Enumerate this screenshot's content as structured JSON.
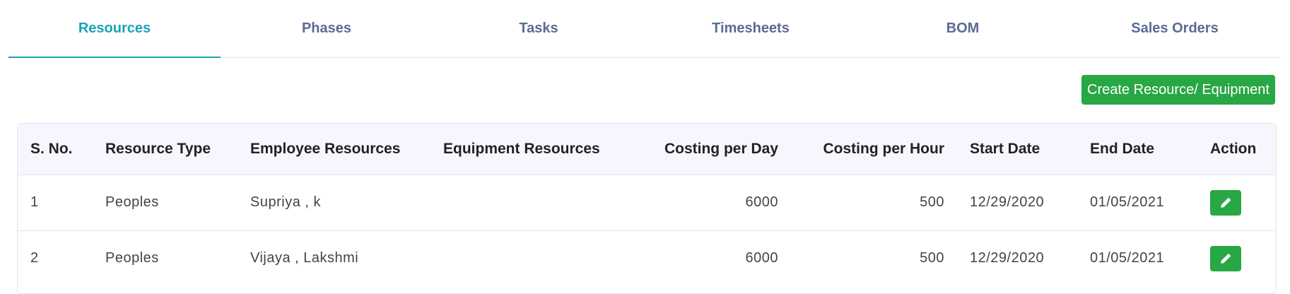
{
  "tabs": [
    {
      "label": "Resources",
      "active": true
    },
    {
      "label": "Phases",
      "active": false
    },
    {
      "label": "Tasks",
      "active": false
    },
    {
      "label": "Timesheets",
      "active": false
    },
    {
      "label": "BOM",
      "active": false
    },
    {
      "label": "Sales Orders",
      "active": false
    }
  ],
  "toolbar": {
    "create_label": "Create Resource/ Equipment"
  },
  "table": {
    "headers": [
      "S. No.",
      "Resource Type",
      "Employee Resources",
      "Equipment Resources",
      "Costing per Day",
      "Costing per Hour",
      "Start Date",
      "End Date",
      "Action"
    ],
    "rows": [
      {
        "sno": "1",
        "type": "Peoples",
        "employee": "Supriya , k",
        "equipment": "",
        "per_day": "6000",
        "per_hour": "500",
        "start": "12/29/2020",
        "end": "01/05/2021"
      },
      {
        "sno": "2",
        "type": "Peoples",
        "employee": "Vijaya , Lakshmi",
        "equipment": "",
        "per_day": "6000",
        "per_hour": "500",
        "start": "12/29/2020",
        "end": "01/05/2021"
      }
    ]
  },
  "icons": {
    "edit": "pencil-icon"
  },
  "colors": {
    "accent": "#1aa3b8",
    "success": "#28a745",
    "tab_text": "#5b6b94",
    "header_bg": "#f7f6fe"
  }
}
